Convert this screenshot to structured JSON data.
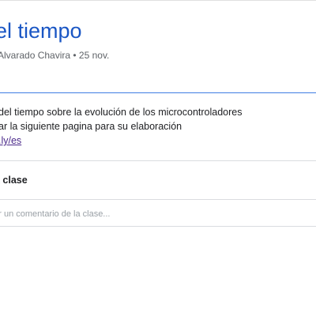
{
  "assignment": {
    "title": "el tiempo",
    "meta": "Alvarado Chavira • 25 nov.",
    "description_lines": [
      "del tiempo sobre la evolución de los microcontroladores",
      "ar la siguiente pagina para su elaboración"
    ],
    "link_text": ".ly/es"
  },
  "comments": {
    "header": "a clase",
    "input_placeholder": "gar un comentario de la clase..."
  },
  "colors": {
    "title": "#1a56c4",
    "accent_divider": "#3f7de3",
    "link": "#4b2a8a"
  }
}
